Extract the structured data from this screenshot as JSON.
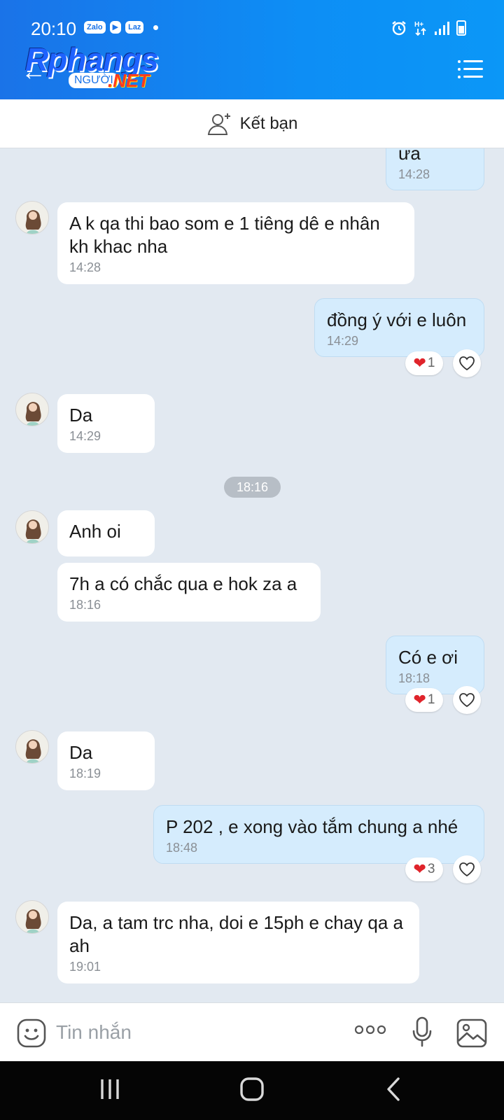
{
  "status_bar": {
    "time": "20:10",
    "apps": [
      "Zalo",
      "▶",
      "Laz"
    ]
  },
  "header": {
    "logo_main": "Rphangs",
    "logo_tag": "NGƯỜI",
    "logo_suffix": ".NET"
  },
  "add_friend": {
    "label": "Kết bạn"
  },
  "messages": [
    {
      "side": "out",
      "text": "ưa",
      "time": "14:28"
    },
    {
      "side": "in",
      "text": "A k qa thi bao som e 1 tiêng dê e nhân kh khac nha",
      "time": "14:28"
    },
    {
      "side": "out",
      "text": "đồng ý với e luôn",
      "time": "14:29",
      "reactions": "1"
    },
    {
      "side": "in",
      "text": "Da",
      "time": "14:29"
    },
    {
      "side": "in",
      "text": "Anh oi",
      "time": ""
    },
    {
      "side": "in",
      "text": "7h a có chắc qua e hok za a",
      "time": "18:16"
    },
    {
      "side": "out",
      "text": "Có e ơi",
      "time": "18:18",
      "reactions": "1"
    },
    {
      "side": "in",
      "text": "Da",
      "time": "18:19"
    },
    {
      "side": "out",
      "text": "P 202 , e xong vào tắm chung a nhé",
      "time": "18:48",
      "reactions": "3"
    },
    {
      "side": "in",
      "text": "Da, a tam trc nha, doi e 15ph e chay qa a ah",
      "time": "19:01"
    }
  ],
  "separator": "18:16",
  "input": {
    "placeholder": "Tin nhắn"
  },
  "colors": {
    "header": "#1a73e8",
    "out_bubble": "#d5ecfd",
    "in_bubble": "#ffffff",
    "chat_bg": "#e2e9f1",
    "heart": "#e0242b"
  }
}
